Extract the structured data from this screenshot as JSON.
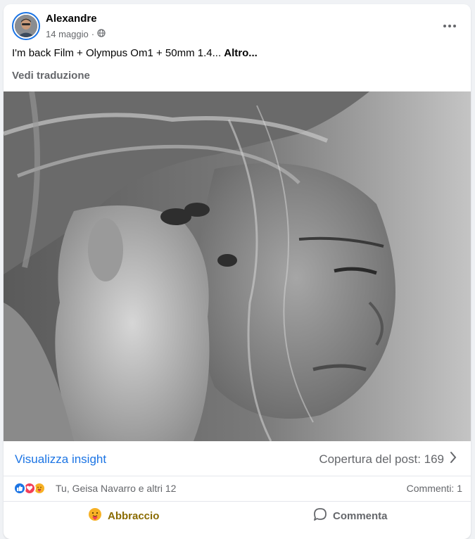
{
  "post": {
    "author": "Alexandre",
    "date": "14 maggio",
    "separator": "·",
    "privacy_icon": "globe-icon",
    "text_main": "I'm back Film + Olympus Om1 + 50mm 1.4...",
    "text_more": "Altro...",
    "translate_label": "Vedi traduzione"
  },
  "insights": {
    "link_label": "Visualizza insight",
    "reach_label": "Copertura del post: 169"
  },
  "reactions": {
    "icons": [
      "like-icon",
      "love-icon",
      "care-icon"
    ],
    "summary": "Tu, Geisa Navarro e altri 12",
    "comments": "Commenti: 1"
  },
  "actions": {
    "hug_label": "Abbraccio",
    "comment_label": "Commenta"
  },
  "colors": {
    "brand_blue": "#1b74e4",
    "love_red": "#f33e58",
    "care_yellow": "#f7b125",
    "hug_text": "#8a6b00"
  }
}
